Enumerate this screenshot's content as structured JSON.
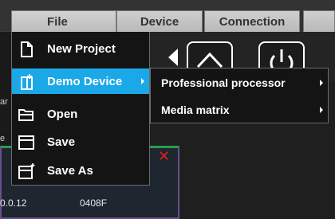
{
  "menubar": {
    "tabs": [
      {
        "label": "File"
      },
      {
        "label": "Device"
      },
      {
        "label": "Connection"
      }
    ]
  },
  "file_menu": {
    "items": [
      {
        "label": "New Project",
        "icon": "new-document-icon"
      },
      {
        "label": "Demo Device",
        "icon": "document-star-icon",
        "highlighted": true,
        "has_submenu": true
      },
      {
        "label": "Open",
        "icon": "folder-open-icon"
      },
      {
        "label": "Save",
        "icon": "save-window-icon"
      },
      {
        "label": "Save As",
        "icon": "save-as-window-icon"
      }
    ]
  },
  "demo_submenu": {
    "items": [
      {
        "label": "Professional processor",
        "has_submenu": true
      },
      {
        "label": "Media matrix",
        "has_submenu": true
      }
    ]
  },
  "toolbar": {
    "icons": [
      "left-arrow-icon",
      "up-arrow-icon",
      "power-icon"
    ]
  },
  "device_card": {
    "ip": "0.0.12",
    "id": "0408F",
    "close_symbol": "✕"
  },
  "side_fragments": [
    "ar",
    "e",
    "ID"
  ],
  "colors": {
    "highlight": "#1aa8e8",
    "menu_bg": "#141414",
    "card_border": "#6a4e8c",
    "card_top": "#2e9a4e",
    "close": "#e02020"
  }
}
